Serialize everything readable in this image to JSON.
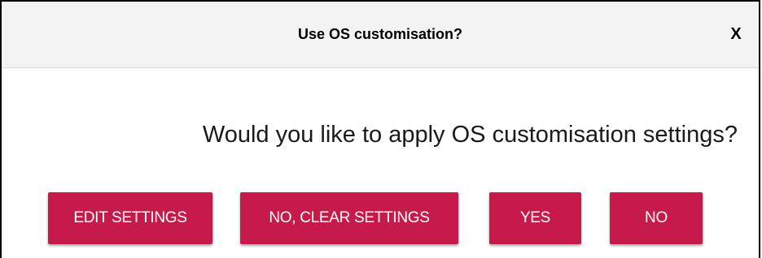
{
  "dialog": {
    "title": "Use OS customisation?",
    "close_label": "X",
    "question": "Would you like to apply OS customisation settings?",
    "buttons": {
      "edit_settings": "EDIT SETTINGS",
      "no_clear_settings": "NO, CLEAR SETTINGS",
      "yes": "YES",
      "no": "NO"
    }
  },
  "colors": {
    "button_background": "#c51a4a",
    "button_text": "#ffffff",
    "title_bar": "#f3f3f3"
  },
  "icons": {
    "close": "close-icon"
  }
}
